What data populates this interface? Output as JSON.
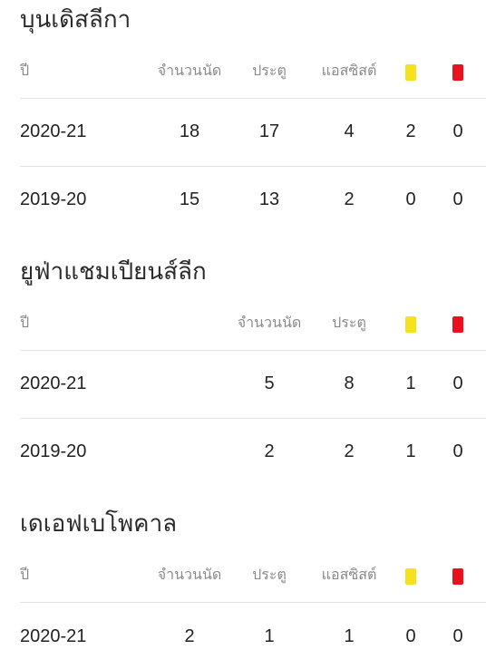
{
  "sections": [
    {
      "title": "บุนเดิสลีกา",
      "headers": {
        "season": "ปี",
        "appearances": "จำนวนนัด",
        "goals": "ประตู",
        "assists": "แอสซิสต์",
        "yellow_card_icon": "yellow-card",
        "red_card_icon": "red-card"
      },
      "rows": [
        {
          "season": "2020-21",
          "appearances": "18",
          "goals": "17",
          "assists": "4",
          "yellow": "2",
          "red": "0"
        },
        {
          "season": "2019-20",
          "appearances": "15",
          "goals": "13",
          "assists": "2",
          "yellow": "0",
          "red": "0"
        }
      ]
    },
    {
      "title": "ยูฟ่าแชมเปียนส์ลีก",
      "headers": {
        "season": "ปี",
        "appearances": "จำนวนนัด",
        "goals": "ประตู",
        "yellow_card_icon": "yellow-card",
        "red_card_icon": "red-card"
      },
      "rows": [
        {
          "season": "2020-21",
          "appearances": "5",
          "goals": "8",
          "yellow": "1",
          "red": "0"
        },
        {
          "season": "2019-20",
          "appearances": "2",
          "goals": "2",
          "yellow": "1",
          "red": "0"
        }
      ]
    },
    {
      "title": "เดเอฟเบโพคาล",
      "headers": {
        "season": "ปี",
        "appearances": "จำนวนนัด",
        "goals": "ประตู",
        "assists": "แอสซิสต์",
        "yellow_card_icon": "yellow-card",
        "red_card_icon": "red-card"
      },
      "rows": [
        {
          "season": "2020-21",
          "appearances": "2",
          "goals": "1",
          "assists": "1",
          "yellow": "0",
          "red": "0"
        }
      ]
    }
  ],
  "colors": {
    "yellow_card": "#f5e11c",
    "red_card": "#e8111d",
    "header_text": "#8a8a8a",
    "divider": "#e2e2e2"
  }
}
